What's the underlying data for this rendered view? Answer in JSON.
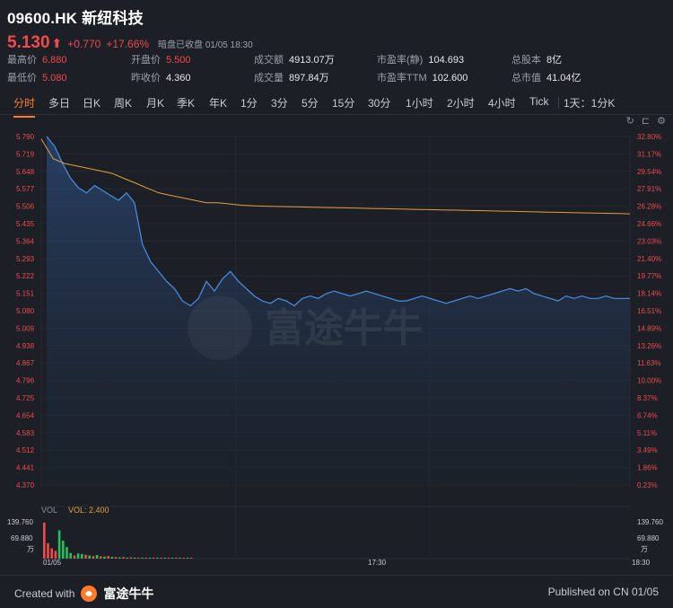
{
  "header": {
    "title": "09600.HK 新纽科技",
    "price": "5.130",
    "change": "+0.770",
    "change_pct": "+17.66%",
    "status": "暗盘已收盘 01/05 18:30"
  },
  "stats": [
    {
      "key": "最高价",
      "value": "6.880",
      "tone": "red"
    },
    {
      "key": "开盘价",
      "value": "5.500",
      "tone": "red"
    },
    {
      "key": "成交额",
      "value": "4913.07万",
      "tone": "white"
    },
    {
      "key": "市盈率(静)",
      "value": "104.693",
      "tone": "white"
    },
    {
      "key": "总股本",
      "value": "8亿",
      "tone": "white"
    },
    {
      "key": "最低价",
      "value": "5.080",
      "tone": "red"
    },
    {
      "key": "昨收价",
      "value": "4.360",
      "tone": "white"
    },
    {
      "key": "成交量",
      "value": "897.84万",
      "tone": "white"
    },
    {
      "key": "市盈率TTM",
      "value": "102.600",
      "tone": "white"
    },
    {
      "key": "总市值",
      "value": "41.04亿",
      "tone": "white"
    }
  ],
  "tabs": [
    "分时",
    "多日",
    "日K",
    "周K",
    "月K",
    "季K",
    "年K",
    "1分",
    "3分",
    "5分",
    "15分",
    "30分",
    "1小时",
    "2小时",
    "4小时",
    "Tick",
    "1天：1分K"
  ],
  "active_tab": "分时",
  "toolbar": {
    "icons": [
      "refresh-icon",
      "chart-type-icon",
      "settings-icon"
    ]
  },
  "volume_legend": {
    "label": "VOL",
    "value": "VOL: 2.400"
  },
  "watermark": "富途牛牛",
  "footer": {
    "created_label": "Created with",
    "brand": "富途牛牛",
    "published": "Published on CN 01/05"
  },
  "colors": {
    "up": "#f04a4a",
    "down": "#21c15f",
    "price_line": "#4a90e2",
    "avg_line": "#e0a23a",
    "accent": "#ff7a2a"
  },
  "chart_data": {
    "type": "line",
    "prev_close": 4.36,
    "y_ticks": [
      "5.790",
      "5.719",
      "5.648",
      "5.577",
      "5.506",
      "5.435",
      "5.364",
      "5.293",
      "5.222",
      "5.151",
      "5.080",
      "5.009",
      "4.938",
      "4.867",
      "4.796",
      "4.725",
      "4.654",
      "4.583",
      "4.512",
      "4.441",
      "4.370"
    ],
    "pct_ticks": [
      "32.80%",
      "31.17%",
      "29.54%",
      "27.91%",
      "26.28%",
      "24.66%",
      "23.03%",
      "21.40%",
      "19.77%",
      "18.14%",
      "16.51%",
      "14.89%",
      "13.26%",
      "11.63%",
      "10.00%",
      "8.37%",
      "6.74%",
      "5.11%",
      "3.49%",
      "1.86%",
      "0.23%"
    ],
    "ylim": [
      4.37,
      5.79
    ],
    "x_labels": [
      "01/05",
      "17:30",
      "18:30"
    ],
    "price": [
      5.79,
      5.75,
      5.68,
      5.62,
      5.58,
      5.56,
      5.59,
      5.57,
      5.55,
      5.53,
      5.56,
      5.52,
      5.35,
      5.28,
      5.24,
      5.2,
      5.17,
      5.12,
      5.1,
      5.13,
      5.2,
      5.16,
      5.21,
      5.24,
      5.2,
      5.17,
      5.14,
      5.12,
      5.11,
      5.13,
      5.12,
      5.1,
      5.13,
      5.14,
      5.13,
      5.15,
      5.16,
      5.15,
      5.14,
      5.15,
      5.16,
      5.15,
      5.14,
      5.13,
      5.12,
      5.12,
      5.13,
      5.14,
      5.13,
      5.12,
      5.11,
      5.12,
      5.13,
      5.14,
      5.13,
      5.14,
      5.15,
      5.16,
      5.17,
      5.16,
      5.17,
      5.15,
      5.14,
      5.13,
      5.12,
      5.14,
      5.13,
      5.14,
      5.13,
      5.13,
      5.14,
      5.13,
      5.13,
      5.13
    ],
    "avg": [
      5.78,
      5.7,
      5.68,
      5.67,
      5.66,
      5.65,
      5.64,
      5.62,
      5.6,
      5.58,
      5.56,
      5.55,
      5.54,
      5.53,
      5.52,
      5.52,
      5.515,
      5.51,
      5.508,
      5.506,
      5.505,
      5.504,
      5.503,
      5.502,
      5.501,
      5.5,
      5.499,
      5.498,
      5.497,
      5.496,
      5.495,
      5.494,
      5.493,
      5.492,
      5.491,
      5.49,
      5.489,
      5.488,
      5.487,
      5.486,
      5.485,
      5.484,
      5.483,
      5.482,
      5.481,
      5.48,
      5.479,
      5.478,
      5.477,
      5.476,
      5.475
    ],
    "volume_ticks": [
      "139.760",
      "69.880",
      "万"
    ],
    "volume": [
      {
        "v": 139.8,
        "up": true
      },
      {
        "v": 60,
        "up": true
      },
      {
        "v": 40,
        "up": true
      },
      {
        "v": 30,
        "up": true
      },
      {
        "v": 110,
        "up": false
      },
      {
        "v": 70,
        "up": false
      },
      {
        "v": 45,
        "up": false
      },
      {
        "v": 22,
        "up": false
      },
      {
        "v": 12,
        "up": true
      },
      {
        "v": 20,
        "up": false
      },
      {
        "v": 18,
        "up": false
      },
      {
        "v": 15,
        "up": true
      },
      {
        "v": 12,
        "up": false
      },
      {
        "v": 10,
        "up": true
      },
      {
        "v": 14,
        "up": false
      },
      {
        "v": 9,
        "up": true
      },
      {
        "v": 8,
        "up": false
      },
      {
        "v": 10,
        "up": true
      },
      {
        "v": 7,
        "up": false
      },
      {
        "v": 6,
        "up": true
      },
      {
        "v": 5,
        "up": false
      },
      {
        "v": 6,
        "up": true
      },
      {
        "v": 4,
        "up": false
      },
      {
        "v": 5,
        "up": true
      },
      {
        "v": 4,
        "up": false
      },
      {
        "v": 3,
        "up": true
      },
      {
        "v": 3,
        "up": false
      },
      {
        "v": 3,
        "up": true
      },
      {
        "v": 2,
        "up": false
      },
      {
        "v": 2,
        "up": true
      },
      {
        "v": 2,
        "up": false
      },
      {
        "v": 2,
        "up": true
      },
      {
        "v": 2,
        "up": false
      },
      {
        "v": 2,
        "up": true
      },
      {
        "v": 1,
        "up": false
      },
      {
        "v": 2,
        "up": true
      },
      {
        "v": 1,
        "up": false
      },
      {
        "v": 1,
        "up": true
      },
      {
        "v": 1,
        "up": false
      },
      {
        "v": 1,
        "up": true
      }
    ]
  }
}
